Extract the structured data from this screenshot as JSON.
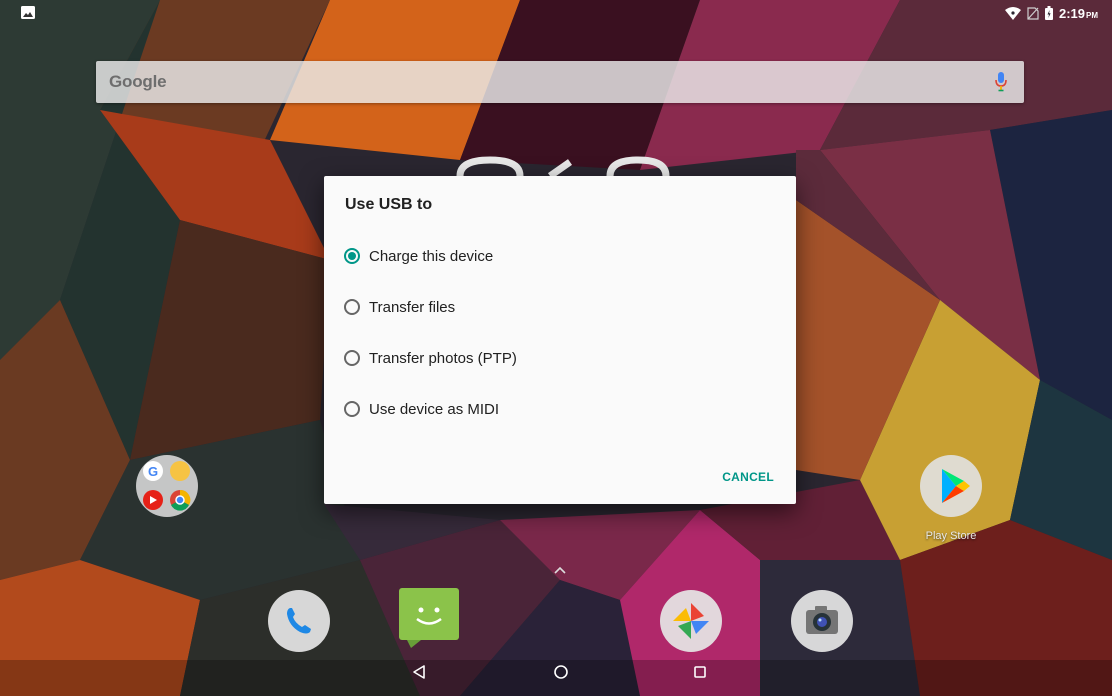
{
  "status_bar": {
    "time": "2:19",
    "ampm": "PM",
    "icons": [
      "image-notification-icon",
      "wifi-icon",
      "no-sim-icon",
      "battery-icon"
    ]
  },
  "search": {
    "logo": "Google",
    "icons": [
      "mic-icon"
    ]
  },
  "dialog": {
    "title": "Use USB to",
    "options": [
      {
        "label": "Charge this device",
        "selected": true
      },
      {
        "label": "Transfer files",
        "selected": false
      },
      {
        "label": "Transfer photos (PTP)",
        "selected": false
      },
      {
        "label": "Use device as MIDI",
        "selected": false
      }
    ],
    "cancel_label": "CANCEL",
    "accent": "#009688"
  },
  "home": {
    "apps": [
      {
        "label": "",
        "icon": "google-folder-icon"
      },
      {
        "label": "Play Store",
        "icon": "play-store-icon"
      }
    ],
    "dock": [
      {
        "icon": "phone-icon"
      },
      {
        "icon": "messaging-icon"
      },
      {
        "icon": "photos-icon"
      },
      {
        "icon": "camera-icon"
      }
    ],
    "drawer_icon": "chevron-up-icon"
  },
  "nav_bar": {
    "icons": [
      "back-icon",
      "home-icon",
      "recents-icon"
    ]
  }
}
